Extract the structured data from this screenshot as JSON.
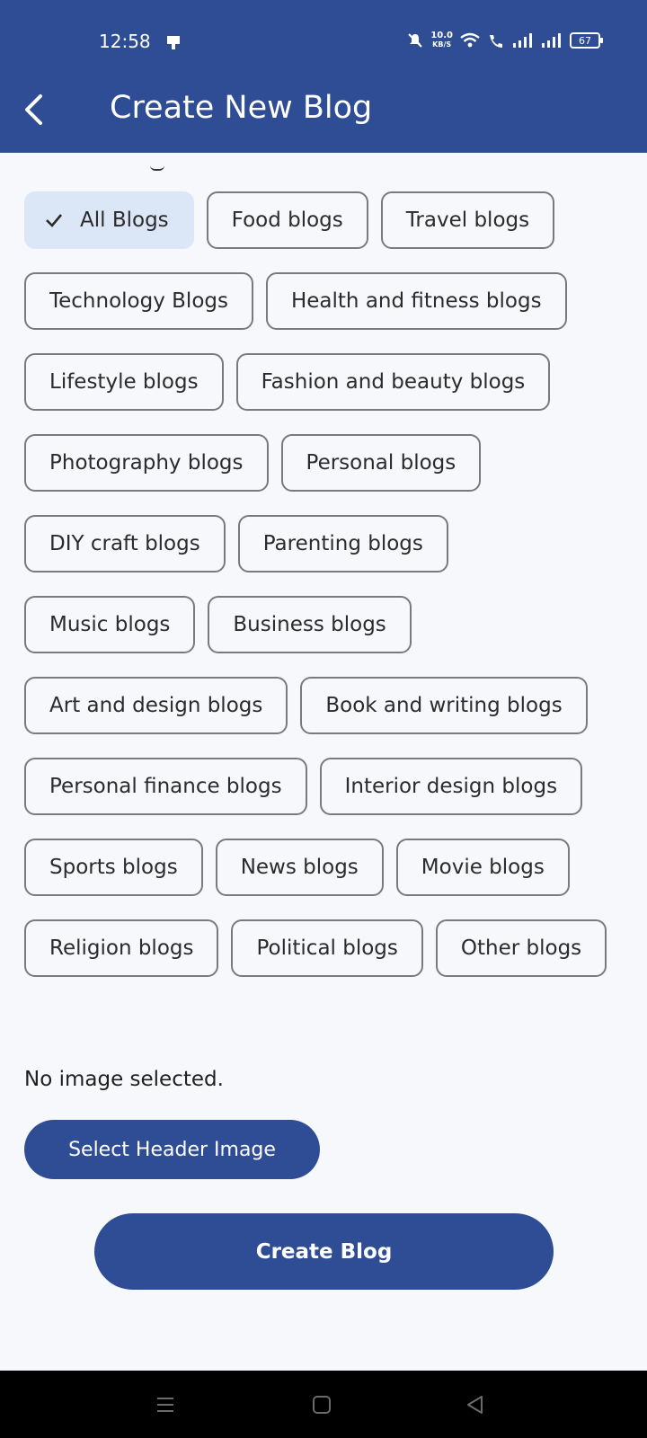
{
  "status_bar": {
    "time": "12:58",
    "net_speed_value": "10.0",
    "net_speed_unit": "KB/S",
    "battery": "67"
  },
  "header": {
    "title": "Create New Blog",
    "back_icon": "chevron-left-icon"
  },
  "categories": {
    "chips": [
      {
        "label": "All Blogs",
        "selected": true
      },
      {
        "label": "Food blogs",
        "selected": false
      },
      {
        "label": "Travel blogs",
        "selected": false
      },
      {
        "label": "Technology Blogs",
        "selected": false
      },
      {
        "label": "Health and fitness blogs",
        "selected": false
      },
      {
        "label": "Lifestyle blogs",
        "selected": false
      },
      {
        "label": "Fashion and beauty blogs",
        "selected": false
      },
      {
        "label": "Photography blogs",
        "selected": false
      },
      {
        "label": "Personal blogs",
        "selected": false
      },
      {
        "label": "DIY craft blogs",
        "selected": false
      },
      {
        "label": "Parenting blogs",
        "selected": false
      },
      {
        "label": "Music blogs",
        "selected": false
      },
      {
        "label": "Business blogs",
        "selected": false
      },
      {
        "label": "Art and design blogs",
        "selected": false
      },
      {
        "label": "Book and writing blogs",
        "selected": false
      },
      {
        "label": "Personal finance blogs",
        "selected": false
      },
      {
        "label": "Interior design blogs",
        "selected": false
      },
      {
        "label": "Sports blogs",
        "selected": false
      },
      {
        "label": "News blogs",
        "selected": false
      },
      {
        "label": "Movie blogs",
        "selected": false
      },
      {
        "label": "Religion blogs",
        "selected": false
      },
      {
        "label": "Political blogs",
        "selected": false
      },
      {
        "label": "Other blogs",
        "selected": false
      }
    ]
  },
  "image_section": {
    "status_text": "No image selected.",
    "select_button_label": "Select Header Image"
  },
  "actions": {
    "create_button_label": "Create Blog"
  },
  "colors": {
    "primary": "#2e4d95",
    "selected_chip_bg": "#dbe6f6",
    "background": "#f7f8fc"
  }
}
